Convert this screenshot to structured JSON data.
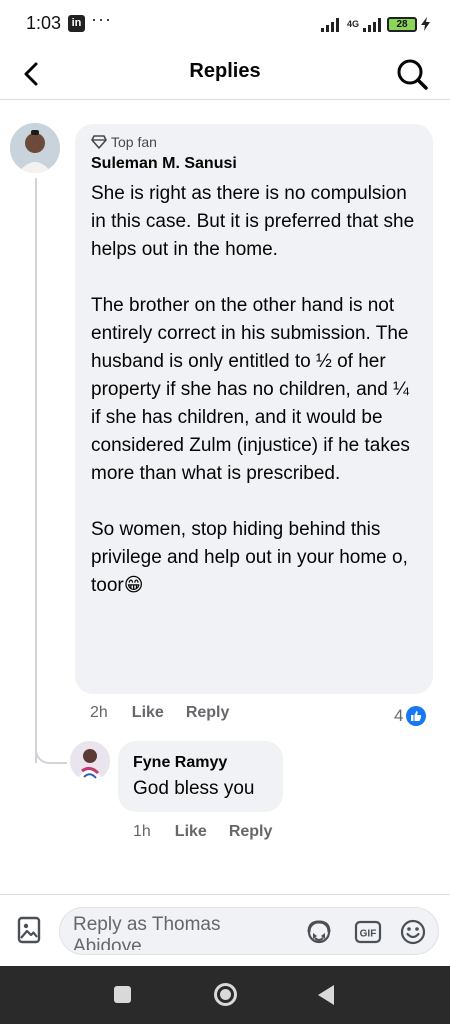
{
  "status_bar": {
    "time": "1:03",
    "linkedin_icon": "linkedin-icon",
    "more": "···",
    "network": "4G",
    "battery": "28"
  },
  "header": {
    "title": "Replies",
    "back_icon": "back-arrow-icon",
    "search_icon": "search-icon"
  },
  "comment": {
    "badge": "Top fan",
    "author": "Suleman M. Sanusi",
    "paragraphs": [
      "She is right as there is no compulsion in this case. But it is preferred that she helps out in the home.",
      "The brother on the other hand is not entirely correct in his submission. The husband is only entitled to ½ of her property if she has no children, and ¼ if she has children, and it would be considered Zulm (injustice) if he takes more than what is prescribed.",
      "So women, stop hiding behind this privilege and help out in your home o, toor😁"
    ],
    "time": "2h",
    "like_label": "Like",
    "reply_label": "Reply",
    "reaction_count": "4"
  },
  "reply": {
    "author": "Fyne Ramyy",
    "text": "God bless you",
    "time": "1h",
    "like_label": "Like",
    "reply_label": "Reply"
  },
  "composer": {
    "placeholder": "Reply as Thomas Abidoye"
  },
  "colors": {
    "bubble": "#f0f2f5",
    "like_blue": "#1877f2",
    "secondary_text": "#65676b"
  }
}
